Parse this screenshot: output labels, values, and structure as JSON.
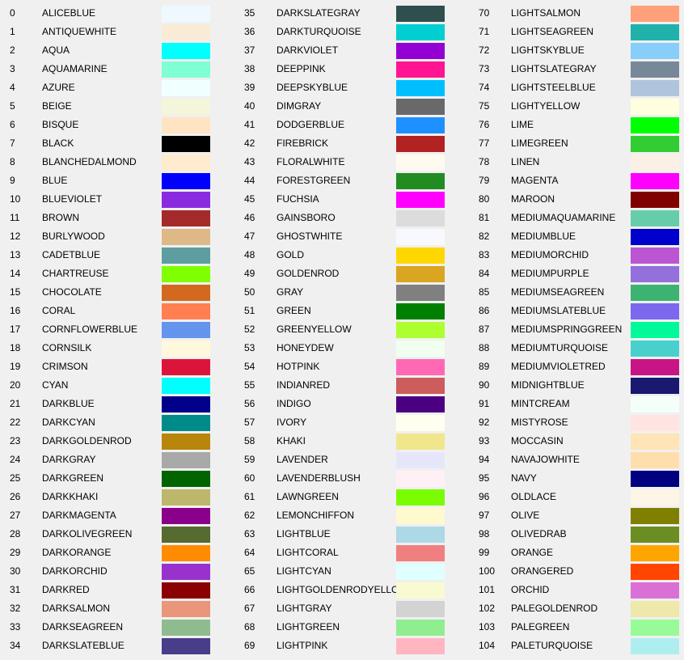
{
  "colors": [
    {
      "index": "0",
      "name": "ALICEBLUE",
      "color": "#F0F8FF"
    },
    {
      "index": "1",
      "name": "ANTIQUEWHITE",
      "color": "#FAEBD7"
    },
    {
      "index": "2",
      "name": "AQUA",
      "color": "#00FFFF"
    },
    {
      "index": "3",
      "name": "AQUAMARINE",
      "color": "#7FFFD4"
    },
    {
      "index": "4",
      "name": "AZURE",
      "color": "#F0FFFF"
    },
    {
      "index": "5",
      "name": "BEIGE",
      "color": "#F5F5DC"
    },
    {
      "index": "6",
      "name": "BISQUE",
      "color": "#FFE4C4"
    },
    {
      "index": "7",
      "name": "BLACK",
      "color": "#000000"
    },
    {
      "index": "8",
      "name": "BLANCHEDALMOND",
      "color": "#FFEBCD"
    },
    {
      "index": "9",
      "name": "BLUE",
      "color": "#0000FF"
    },
    {
      "index": "10",
      "name": "BLUEVIOLET",
      "color": "#8A2BE2"
    },
    {
      "index": "11",
      "name": "BROWN",
      "color": "#A52A2A"
    },
    {
      "index": "12",
      "name": "BURLYWOOD",
      "color": "#DEB887"
    },
    {
      "index": "13",
      "name": "CADETBLUE",
      "color": "#5F9EA0"
    },
    {
      "index": "14",
      "name": "CHARTREUSE",
      "color": "#7FFF00"
    },
    {
      "index": "15",
      "name": "CHOCOLATE",
      "color": "#D2691E"
    },
    {
      "index": "16",
      "name": "CORAL",
      "color": "#FF7F50"
    },
    {
      "index": "17",
      "name": "CORNFLOWERBLUE",
      "color": "#6495ED"
    },
    {
      "index": "18",
      "name": "CORNSILK",
      "color": "#FFF8DC"
    },
    {
      "index": "19",
      "name": "CRIMSON",
      "color": "#DC143C"
    },
    {
      "index": "20",
      "name": "CYAN",
      "color": "#00FFFF"
    },
    {
      "index": "21",
      "name": "DARKBLUE",
      "color": "#00008B"
    },
    {
      "index": "22",
      "name": "DARKCYAN",
      "color": "#008B8B"
    },
    {
      "index": "23",
      "name": "DARKGOLDENROD",
      "color": "#B8860B"
    },
    {
      "index": "24",
      "name": "DARKGRAY",
      "color": "#A9A9A9"
    },
    {
      "index": "25",
      "name": "DARKGREEN",
      "color": "#006400"
    },
    {
      "index": "26",
      "name": "DARKKHAKI",
      "color": "#BDB76B"
    },
    {
      "index": "27",
      "name": "DARKMAGENTA",
      "color": "#8B008B"
    },
    {
      "index": "28",
      "name": "DARKOLIVEGREEN",
      "color": "#556B2F"
    },
    {
      "index": "29",
      "name": "DARKORANGE",
      "color": "#FF8C00"
    },
    {
      "index": "30",
      "name": "DARKORCHID",
      "color": "#9932CC"
    },
    {
      "index": "31",
      "name": "DARKRED",
      "color": "#8B0000"
    },
    {
      "index": "32",
      "name": "DARKSALMON",
      "color": "#E9967A"
    },
    {
      "index": "33",
      "name": "DARKSEAGREEN",
      "color": "#8FBC8F"
    },
    {
      "index": "34",
      "name": "DARKSLATEBLUE",
      "color": "#483D8B"
    },
    {
      "index": "35",
      "name": "DARKSLATEGRAY",
      "color": "#2F4F4F"
    },
    {
      "index": "36",
      "name": "DARKTURQUOISE",
      "color": "#00CED1"
    },
    {
      "index": "37",
      "name": "DARKVIOLET",
      "color": "#9400D3"
    },
    {
      "index": "38",
      "name": "DEEPPINK",
      "color": "#FF1493"
    },
    {
      "index": "39",
      "name": "DEEPSKYBLUE",
      "color": "#00BFFF"
    },
    {
      "index": "40",
      "name": "DIMGRAY",
      "color": "#696969"
    },
    {
      "index": "41",
      "name": "DODGERBLUE",
      "color": "#1E90FF"
    },
    {
      "index": "42",
      "name": "FIREBRICK",
      "color": "#B22222"
    },
    {
      "index": "43",
      "name": "FLORALWHITE",
      "color": "#FFFAF0"
    },
    {
      "index": "44",
      "name": "FORESTGREEN",
      "color": "#228B22"
    },
    {
      "index": "45",
      "name": "FUCHSIA",
      "color": "#FF00FF"
    },
    {
      "index": "46",
      "name": "GAINSBORO",
      "color": "#DCDCDC"
    },
    {
      "index": "47",
      "name": "GHOSTWHITE",
      "color": "#F8F8FF"
    },
    {
      "index": "48",
      "name": "GOLD",
      "color": "#FFD700"
    },
    {
      "index": "49",
      "name": "GOLDENROD",
      "color": "#DAA520"
    },
    {
      "index": "50",
      "name": "GRAY",
      "color": "#808080"
    },
    {
      "index": "51",
      "name": "GREEN",
      "color": "#008000"
    },
    {
      "index": "52",
      "name": "GREENYELLOW",
      "color": "#ADFF2F"
    },
    {
      "index": "53",
      "name": "HONEYDEW",
      "color": "#F0FFF0"
    },
    {
      "index": "54",
      "name": "HOTPINK",
      "color": "#FF69B4"
    },
    {
      "index": "55",
      "name": "INDIANRED",
      "color": "#CD5C5C"
    },
    {
      "index": "56",
      "name": "INDIGO",
      "color": "#4B0082"
    },
    {
      "index": "57",
      "name": "IVORY",
      "color": "#FFFFF0"
    },
    {
      "index": "58",
      "name": "KHAKI",
      "color": "#F0E68C"
    },
    {
      "index": "59",
      "name": "LAVENDER",
      "color": "#E6E6FA"
    },
    {
      "index": "60",
      "name": "LAVENDERBLUSH",
      "color": "#FFF0F5"
    },
    {
      "index": "61",
      "name": "LAWNGREEN",
      "color": "#7CFC00"
    },
    {
      "index": "62",
      "name": "LEMONCHIFFON",
      "color": "#FFFACD"
    },
    {
      "index": "63",
      "name": "LIGHTBLUE",
      "color": "#ADD8E6"
    },
    {
      "index": "64",
      "name": "LIGHTCORAL",
      "color": "#F08080"
    },
    {
      "index": "65",
      "name": "LIGHTCYAN",
      "color": "#E0FFFF"
    },
    {
      "index": "66",
      "name": "LIGHTGOLDENRODYELLOW",
      "color": "#FAFAD2"
    },
    {
      "index": "67",
      "name": "LIGHTGRAY",
      "color": "#D3D3D3"
    },
    {
      "index": "68",
      "name": "LIGHTGREEN",
      "color": "#90EE90"
    },
    {
      "index": "69",
      "name": "LIGHTPINK",
      "color": "#FFB6C1"
    },
    {
      "index": "70",
      "name": "LIGHTSALMON",
      "color": "#FFA07A"
    },
    {
      "index": "71",
      "name": "LIGHTSEAGREEN",
      "color": "#20B2AA"
    },
    {
      "index": "72",
      "name": "LIGHTSKYBLUE",
      "color": "#87CEFA"
    },
    {
      "index": "73",
      "name": "LIGHTSLATEGRAY",
      "color": "#778899"
    },
    {
      "index": "74",
      "name": "LIGHTSTEELBLUE",
      "color": "#B0C4DE"
    },
    {
      "index": "75",
      "name": "LIGHTYELLOW",
      "color": "#FFFFE0"
    },
    {
      "index": "76",
      "name": "LIME",
      "color": "#00FF00"
    },
    {
      "index": "77",
      "name": "LIMEGREEN",
      "color": "#32CD32"
    },
    {
      "index": "78",
      "name": "LINEN",
      "color": "#FAF0E6"
    },
    {
      "index": "79",
      "name": "MAGENTA",
      "color": "#FF00FF"
    },
    {
      "index": "80",
      "name": "MAROON",
      "color": "#800000"
    },
    {
      "index": "81",
      "name": "MEDIUMAQUAMARINE",
      "color": "#66CDAA"
    },
    {
      "index": "82",
      "name": "MEDIUMBLUE",
      "color": "#0000CD"
    },
    {
      "index": "83",
      "name": "MEDIUMORCHID",
      "color": "#BA55D3"
    },
    {
      "index": "84",
      "name": "MEDIUMPURPLE",
      "color": "#9370DB"
    },
    {
      "index": "85",
      "name": "MEDIUMSEAGREEN",
      "color": "#3CB371"
    },
    {
      "index": "86",
      "name": "MEDIUMSLATEBLUE",
      "color": "#7B68EE"
    },
    {
      "index": "87",
      "name": "MEDIUMSPRINGGREEN",
      "color": "#00FA9A"
    },
    {
      "index": "88",
      "name": "MEDIUMTURQUOISE",
      "color": "#48D1CC"
    },
    {
      "index": "89",
      "name": "MEDIUMVIOLETRED",
      "color": "#C71585"
    },
    {
      "index": "90",
      "name": "MIDNIGHTBLUE",
      "color": "#191970"
    },
    {
      "index": "91",
      "name": "MINTCREAM",
      "color": "#F5FFFA"
    },
    {
      "index": "92",
      "name": "MISTYROSE",
      "color": "#FFE4E1"
    },
    {
      "index": "93",
      "name": "MOCCASIN",
      "color": "#FFE4B5"
    },
    {
      "index": "94",
      "name": "NAVAJOWHITE",
      "color": "#FFDEAD"
    },
    {
      "index": "95",
      "name": "NAVY",
      "color": "#000080"
    },
    {
      "index": "96",
      "name": "OLDLACE",
      "color": "#FDF5E6"
    },
    {
      "index": "97",
      "name": "OLIVE",
      "color": "#808000"
    },
    {
      "index": "98",
      "name": "OLIVEDRAB",
      "color": "#6B8E23"
    },
    {
      "index": "99",
      "name": "ORANGE",
      "color": "#FFA500"
    },
    {
      "index": "100",
      "name": "ORANGERED",
      "color": "#FF4500"
    },
    {
      "index": "101",
      "name": "ORCHID",
      "color": "#DA70D6"
    },
    {
      "index": "102",
      "name": "PALEGOLDENROD",
      "color": "#EEE8AA"
    },
    {
      "index": "103",
      "name": "PALEGREEN",
      "color": "#98FB98"
    },
    {
      "index": "104",
      "name": "PALETURQUOISE",
      "color": "#AFEEEE"
    }
  ]
}
